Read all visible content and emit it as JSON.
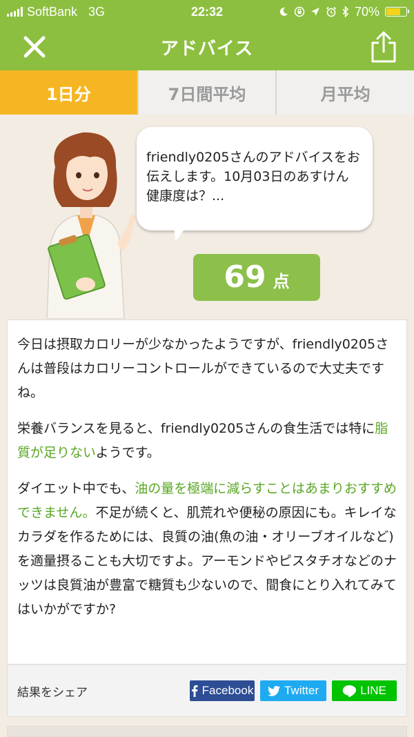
{
  "status_bar": {
    "carrier": "SoftBank",
    "network": "3G",
    "time": "22:32",
    "battery": "70%",
    "battery_level": 0.7,
    "icons": [
      "signal-icon",
      "moon-icon",
      "lock-rotation-icon",
      "location-icon",
      "alarm-icon",
      "bluetooth-icon",
      "battery-icon"
    ]
  },
  "header": {
    "title": "アドバイス",
    "close_icon": "close-icon",
    "share_icon": "share-icon"
  },
  "tabs": [
    {
      "label": "1日分",
      "active": true
    },
    {
      "label": "7日間平均",
      "active": false
    },
    {
      "label": "月平均",
      "active": false
    }
  ],
  "advice": {
    "bubble_text": "friendly0205さんのアドバイスをお伝えします。10月03日のあすけん健康度は？...",
    "score_value": "69",
    "score_unit": "点"
  },
  "body": {
    "p1": "今日は摂取カロリーが少なかったようですが、friendly0205さんは普段はカロリーコントロールができているので大丈夫ですね。",
    "p2_before": "栄養バランスを見ると、friendly0205さんの食生活では特に",
    "p2_highlight": "脂質が足りない",
    "p2_after": "ようです。",
    "p3_before": "ダイエット中でも、",
    "p3_highlight": "油の量を極端に減らすことはあまりおすすめできません。",
    "p3_after": "不足が続くと、肌荒れや便秘の原因にも。キレイなカラダを作るためには、良質の油(魚の油・オリーブオイルなど)を適量摂ることも大切ですよ。アーモンドやピスタチオなどのナッツは良質油が豊富で糖質も少ないので、間食にとり入れてみてはいかがですか?"
  },
  "share": {
    "label": "結果をシェア",
    "facebook": "Facebook",
    "twitter": "Twitter",
    "line": "LINE"
  },
  "colors": {
    "header_green": "#8cbf3f",
    "tab_active": "#f6b623",
    "highlight_green": "#5aa624",
    "facebook": "#2d4d94",
    "twitter": "#1eaaf1",
    "line": "#00c300"
  }
}
